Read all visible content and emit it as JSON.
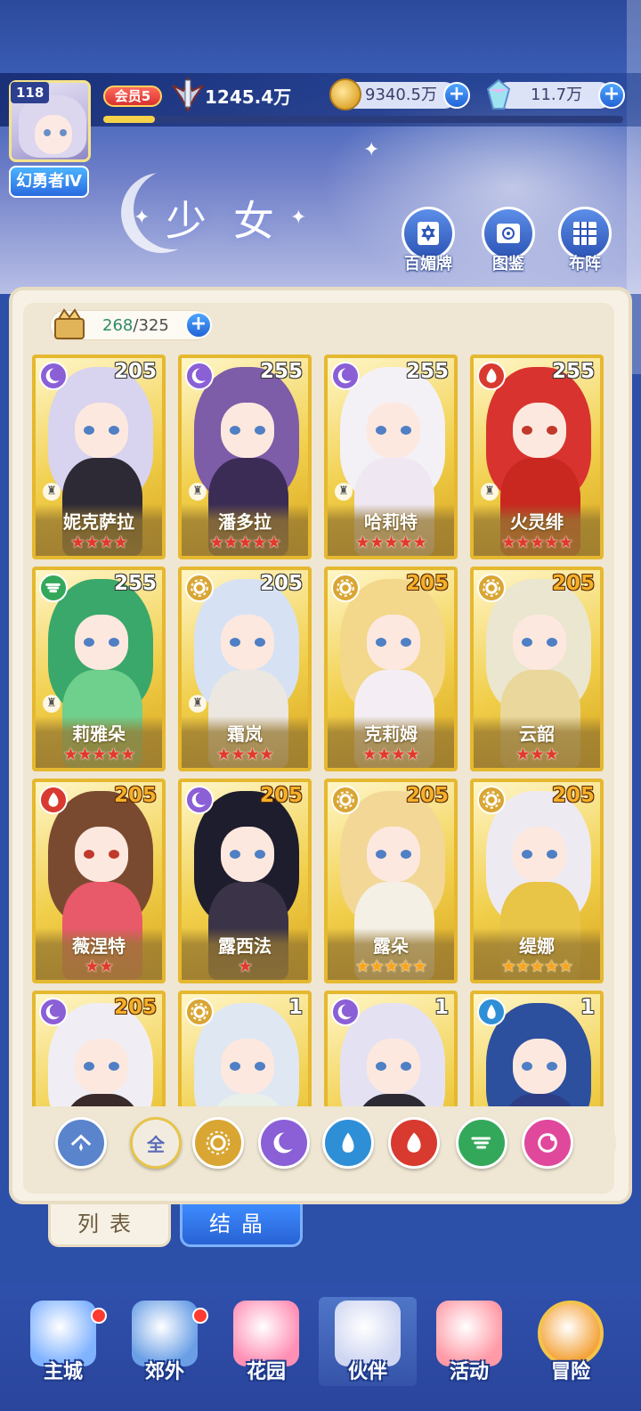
{
  "header": {
    "level": "118",
    "rank": "幻勇者Ⅳ",
    "vip": "会员5",
    "power": "1245.4万",
    "xp_progress": 0.1,
    "coins": "9340.5万",
    "gems": "11.7万",
    "plus": "+"
  },
  "section_title": "少女",
  "top_buttons": [
    {
      "label": "百媚牌",
      "icon": "card-deck-icon"
    },
    {
      "label": "图鉴",
      "icon": "book-icon"
    },
    {
      "label": "布阵",
      "icon": "formation-grid-icon"
    }
  ],
  "capacity": {
    "current": "268",
    "sep": "/",
    "max": "325"
  },
  "characters": [
    {
      "name": "妮克萨拉",
      "level": "205",
      "element": "moon",
      "stars": 4,
      "star_color": "red",
      "hair": "#d8d3ee",
      "outfit": "#2d2a36",
      "level_color": "white"
    },
    {
      "name": "潘多拉",
      "level": "255",
      "element": "moon",
      "stars": 5,
      "star_color": "red",
      "hair": "#7d5ca8",
      "outfit": "#3a2c55",
      "level_color": "white"
    },
    {
      "name": "哈莉特",
      "level": "255",
      "element": "moon",
      "stars": 5,
      "star_color": "red",
      "hair": "#f3f1f6",
      "outfit": "#efe8f2",
      "level_color": "white"
    },
    {
      "name": "火灵绯",
      "level": "255",
      "element": "fire",
      "stars": 5,
      "star_color": "red",
      "hair": "#d8332f",
      "outfit": "#c8281f",
      "level_color": "white"
    },
    {
      "name": "莉雅朵",
      "level": "255",
      "element": "wind",
      "stars": 5,
      "star_color": "red",
      "hair": "#3aa86a",
      "outfit": "#6fcf8c",
      "level_color": "white"
    },
    {
      "name": "霜岚",
      "level": "205",
      "element": "light",
      "stars": 4,
      "star_color": "red",
      "hair": "#d6e2f4",
      "outfit": "#ece7e0",
      "level_color": "white"
    },
    {
      "name": "克莉姆",
      "level": "205",
      "element": "light",
      "stars": 4,
      "star_color": "red",
      "hair": "#f3d78a",
      "outfit": "#f4eef4",
      "level_color": "orange"
    },
    {
      "name": "云韶",
      "level": "205",
      "element": "light",
      "stars": 3,
      "star_color": "red",
      "hair": "#ebe6cf",
      "outfit": "#e9d79b",
      "level_color": "orange"
    },
    {
      "name": "薇涅特",
      "level": "205",
      "element": "fire",
      "stars": 2,
      "star_color": "red",
      "hair": "#7a4a30",
      "outfit": "#e8596a",
      "level_color": "orange"
    },
    {
      "name": "露西法",
      "level": "205",
      "element": "moon",
      "stars": 1,
      "star_color": "red",
      "hair": "#1e1d2e",
      "outfit": "#3b3448",
      "level_color": "orange"
    },
    {
      "name": "露朵",
      "level": "205",
      "element": "light",
      "stars": 5,
      "star_color": "gold",
      "hair": "#f2d796",
      "outfit": "#f4f0e6",
      "level_color": "orange"
    },
    {
      "name": "缇娜",
      "level": "205",
      "element": "light",
      "stars": 5,
      "star_color": "gold",
      "hair": "#eeeaf2",
      "outfit": "#e8c447",
      "level_color": "orange"
    },
    {
      "name": "",
      "level": "205",
      "element": "moon",
      "stars": 0,
      "star_color": "red",
      "hair": "#f0eef4",
      "outfit": "#3a2a2a",
      "level_color": "orange"
    },
    {
      "name": "",
      "level": "1",
      "element": "light",
      "stars": 0,
      "star_color": "red",
      "hair": "#dfe7f3",
      "outfit": "#e9efe9",
      "level_color": "white"
    },
    {
      "name": "",
      "level": "1",
      "element": "moon",
      "stars": 0,
      "star_color": "red",
      "hair": "#e4e2f2",
      "outfit": "#2e2a34",
      "level_color": "white"
    },
    {
      "name": "",
      "level": "1",
      "element": "water",
      "stars": 0,
      "star_color": "red",
      "hair": "#2c4f9e",
      "outfit": "#2d3e86",
      "level_color": "white"
    }
  ],
  "filters": [
    {
      "key": "all",
      "label": "全",
      "icon": "all-filter",
      "active": true
    },
    {
      "key": "light",
      "label": "",
      "icon": "light-element-icon"
    },
    {
      "key": "moon",
      "label": "",
      "icon": "moon-element-icon"
    },
    {
      "key": "water",
      "label": "",
      "icon": "water-element-icon"
    },
    {
      "key": "fire",
      "label": "",
      "icon": "fire-element-icon"
    },
    {
      "key": "wind",
      "label": "",
      "icon": "wind-element-icon"
    },
    {
      "key": "star",
      "label": "",
      "icon": "star-element-icon"
    }
  ],
  "filter_first": {
    "icon": "angel-element-icon"
  },
  "tabs": {
    "list": "列表",
    "crystal": "结晶"
  },
  "nav": [
    {
      "label": "主城",
      "icon": "castle-icon",
      "badge": true
    },
    {
      "label": "郊外",
      "icon": "portal-icon",
      "badge": true
    },
    {
      "label": "花园",
      "icon": "heart-garden-icon",
      "badge": false
    },
    {
      "label": "伙伴",
      "icon": "partner-icon",
      "badge": false,
      "active": true
    },
    {
      "label": "活动",
      "icon": "gift-box-icon",
      "badge": false
    },
    {
      "label": "冒险",
      "icon": "compass-icon",
      "badge": false
    }
  ],
  "colors": {
    "element_light": "#d9a634",
    "element_moon": "#8b5fd6",
    "element_fire": "#d83a2f",
    "element_wind": "#34a85a",
    "element_water": "#2f8fd6",
    "element_star": "#e0489c",
    "element_angel": "#5a84cc"
  }
}
